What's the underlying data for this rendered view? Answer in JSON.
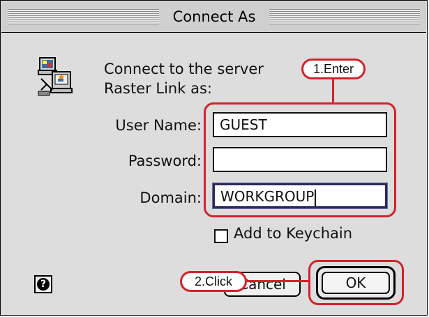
{
  "window": {
    "title": "Connect As"
  },
  "prompt": {
    "line1": "Connect to the server",
    "line2": "Raster Link as:"
  },
  "fields": {
    "user_label": "User Name:",
    "user_value": "GUEST",
    "password_label": "Password:",
    "password_value": "",
    "domain_label": "Domain:",
    "domain_value": "WORKGROUP"
  },
  "keychain": {
    "label": "Add to Keychain",
    "checked": false
  },
  "buttons": {
    "cancel_label": "Cancel",
    "ok_label": "OK",
    "help_symbol": "?"
  },
  "annotations": {
    "enter": "1.Enter",
    "click": "2.Click",
    "color": "#d2232a"
  },
  "icons": {
    "computer": "computer-icon",
    "help": "help-icon"
  }
}
